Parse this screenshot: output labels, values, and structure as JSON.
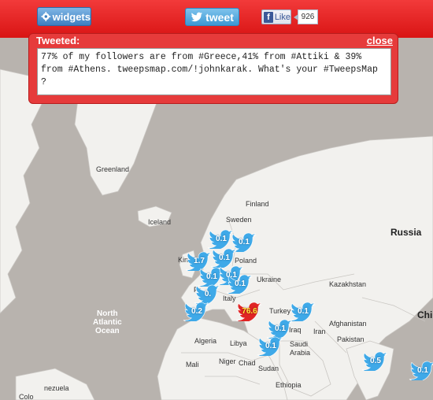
{
  "toolbar": {
    "widgets_label": "widgets",
    "tweet_label": "tweet",
    "like_label": "Like",
    "like_count": "926"
  },
  "dialog": {
    "title": "Tweeted:",
    "close_label": "close",
    "tweet_text": "77% of my followers are from #Greece,41% from #Attiki & 39% from #Athens. tweepsmap.com/!johnkarak. What's your #TweepsMap ?"
  },
  "map": {
    "labels": {
      "greenland": "Greenland",
      "iceland": "Iceland",
      "finland": "Finland",
      "sweden": "Sweden",
      "russia": "Russia",
      "poland": "Poland",
      "ukraine": "Ukraine",
      "kazakhstan": "Kazakhstan",
      "kingdom": "Kin",
      "france": "Fr",
      "italy": "Italy",
      "turkey": "Turkey",
      "iraq": "Iraq",
      "iran": "Iran",
      "afghanistan": "Afghanistan",
      "pakistan": "Pakistan",
      "china": "Chin",
      "algeria": "Algeria",
      "libya": "Libya",
      "saudi_arabia": "Saudi\nArabia",
      "mali": "Mali",
      "niger": "Niger",
      "chad": "Chad",
      "sudan": "Sudan",
      "ethiopia": "Ethiopia",
      "venezuela": "nezuela",
      "colombia": "Colo",
      "ocean": "North\nAtlantic\nOcean"
    },
    "markers": [
      {
        "value": "0.1"
      },
      {
        "value": "0.1"
      },
      {
        "value": "1.7"
      },
      {
        "value": "0.1"
      },
      {
        "value": "0.1"
      },
      {
        "value": "0.1"
      },
      {
        "value": "0.1"
      },
      {
        "value": "0."
      },
      {
        "value": "0.2"
      },
      {
        "value": "76.6"
      },
      {
        "value": "0.1"
      },
      {
        "value": "0.1"
      },
      {
        "value": "0.1"
      },
      {
        "value": "0.5"
      },
      {
        "value": "0.1"
      }
    ]
  },
  "colors": {
    "topbar": "#e02424",
    "ocean": "#b8b3ae",
    "land": "#f2f1ee",
    "marker": "#3fa9e8",
    "hot_marker": "#e02424"
  }
}
